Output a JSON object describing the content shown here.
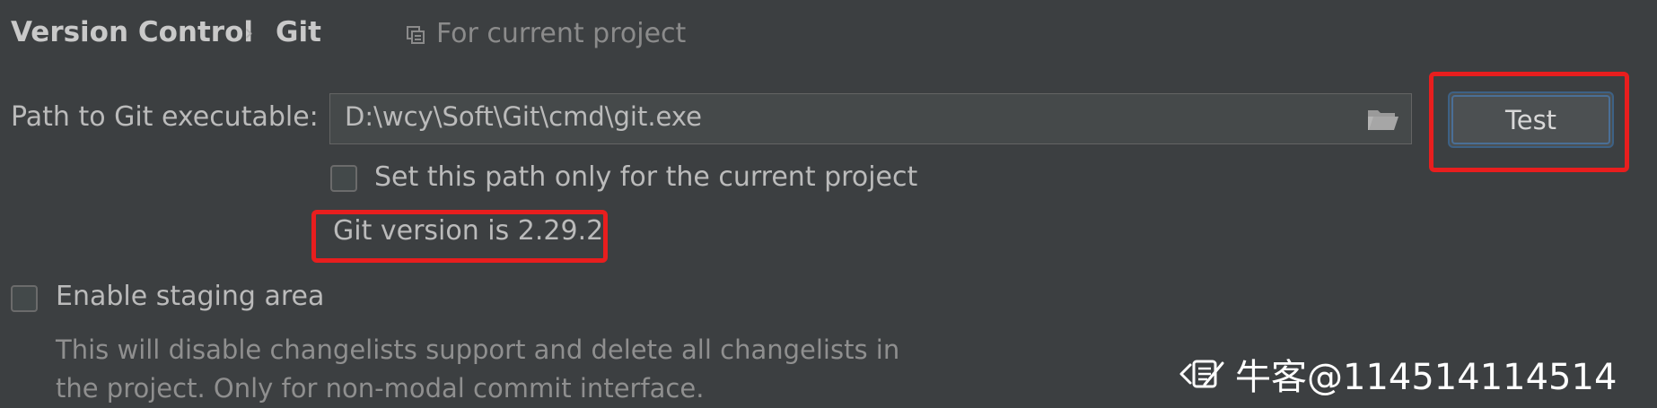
{
  "breadcrumb": {
    "root": "Version Control",
    "separator": "›",
    "current": "Git",
    "scope_label": "For current project"
  },
  "git_path": {
    "label": "Path to Git executable:",
    "value": "D:\\wcy\\Soft\\Git\\cmd\\git.exe",
    "browse_icon": "folder-icon"
  },
  "test_button": {
    "label": "Test"
  },
  "current_project_checkbox": {
    "label": "Set this path only for the current project",
    "checked": false
  },
  "version_status": "Git version is 2.29.2",
  "staging": {
    "label": "Enable staging area",
    "checked": false,
    "description": "This will disable changelists support and delete all changelists in the project. Only for non-modal commit interface."
  },
  "watermark": {
    "text": "牛客@114514114514"
  },
  "colors": {
    "background": "#3c3f41",
    "highlight": "#e81e1e",
    "button_focus": "#3d6185"
  }
}
